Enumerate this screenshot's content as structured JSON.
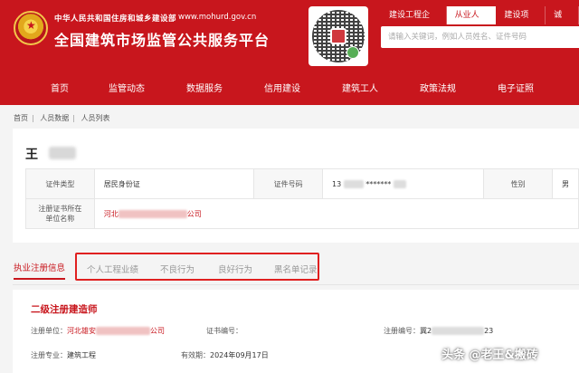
{
  "header": {
    "gov_name": "中华人民共和国住房和城乡建设部",
    "gov_url": "www.mohurd.gov.cn",
    "site_title": "全国建筑市场监管公共服务平台",
    "brand_color": "#c8161d",
    "search_tabs": [
      "建设工程企业",
      "从业人员",
      "建设项目",
      "诚信"
    ],
    "active_search_tab": "从业人员",
    "search_placeholder": "请输入关键词，例如人员姓名、证件号码"
  },
  "nav": {
    "items": [
      "首页",
      "监管动态",
      "数据服务",
      "信用建设",
      "建筑工人",
      "政策法规",
      "电子证照"
    ]
  },
  "breadcrumb": [
    "首页",
    "人员数据",
    "人员列表"
  ],
  "person": {
    "name": "王",
    "id_type_label": "证件类型",
    "id_type": "居民身份证",
    "id_number_label": "证件号码",
    "id_number_prefix": "13",
    "id_number_mask": "*******",
    "gender_label": "性别",
    "gender": "男",
    "cert_unit_label": "注册证书所在单位名称",
    "cert_unit_prefix": "河北",
    "cert_unit_suffix": "公司"
  },
  "tabs": {
    "main": "执业注册信息",
    "others": [
      "个人工程业绩",
      "不良行为",
      "良好行为",
      "黑名单记录"
    ]
  },
  "registration": {
    "title": "二级注册建造师",
    "unit_label": "注册单位：",
    "unit_prefix": "河北雄安",
    "unit_suffix": "公司",
    "cert_no_label": "证书编号：",
    "reg_no_label": "注册编号：",
    "reg_no_prefix": "冀2",
    "reg_no_suffix": "23",
    "major_label": "注册专业：",
    "major": "建筑工程",
    "valid_label": "有效期：",
    "valid": "2024年09月17日"
  },
  "watermark": "头条 @老王&搬砖"
}
